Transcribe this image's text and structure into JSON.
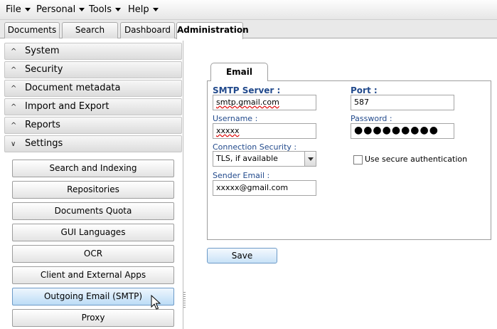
{
  "menubar": {
    "items": [
      "File",
      "Personal",
      "Tools",
      "Help"
    ]
  },
  "tabs": [
    "Documents",
    "Search",
    "Dashboard",
    "Administration"
  ],
  "sidebar": {
    "sections": [
      {
        "label": "System",
        "chevron": "^"
      },
      {
        "label": "Security",
        "chevron": "^"
      },
      {
        "label": "Document metadata",
        "chevron": "^"
      },
      {
        "label": "Import and Export",
        "chevron": "^"
      },
      {
        "label": "Reports",
        "chevron": "^"
      },
      {
        "label": "Settings",
        "chevron": "v"
      }
    ],
    "settings_items": [
      "Search and Indexing",
      "Repositories",
      "Documents Quota",
      "GUI Languages",
      "OCR",
      "Client and External Apps",
      "Outgoing Email (SMTP)",
      "Proxy"
    ],
    "selected_item": "Outgoing Email (SMTP)"
  },
  "email_form": {
    "tab_label": "Email",
    "smtp_server_label": "SMTP Server :",
    "smtp_server_value": "smtp.gmail.com",
    "port_label": "Port :",
    "port_value": "587",
    "username_label": "Username :",
    "username_value": "xxxxx",
    "password_label": "Password :",
    "password_value": "●●●●●●●●●",
    "connection_security_label": "Connection Security :",
    "connection_security_value": "TLS, if available",
    "secure_auth_label": "Use secure authentication",
    "secure_auth_checked": false,
    "sender_email_label": "Sender Email :",
    "sender_email_value": "xxxxx@gmail.com",
    "save_label": "Save"
  },
  "colors": {
    "label_blue": "#224a8c",
    "selected_button": "#bcdcf6"
  }
}
